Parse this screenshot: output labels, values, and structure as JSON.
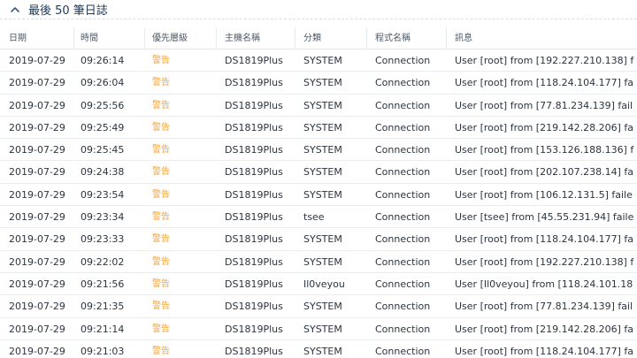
{
  "section": {
    "title": "最後 50 筆日誌",
    "icon": "chevron-up-icon"
  },
  "columns": {
    "date": "日期",
    "time": "時間",
    "level": "優先層級",
    "host": "主機名稱",
    "category": "分類",
    "program": "程式名稱",
    "message": "訊息"
  },
  "colors": {
    "warning": "#f0a33a",
    "header_text": "#233a55"
  },
  "rows": [
    {
      "date": "2019-07-29",
      "time": "09:26:14",
      "level": "警告",
      "host": "DS1819Plus",
      "category": "SYSTEM",
      "program": "Connection",
      "message": "User [root] from [192.227.210.138] f"
    },
    {
      "date": "2019-07-29",
      "time": "09:26:04",
      "level": "警告",
      "host": "DS1819Plus",
      "category": "SYSTEM",
      "program": "Connection",
      "message": "User [root] from [118.24.104.177] fa"
    },
    {
      "date": "2019-07-29",
      "time": "09:25:56",
      "level": "警告",
      "host": "DS1819Plus",
      "category": "SYSTEM",
      "program": "Connection",
      "message": "User [root] from [77.81.234.139] fail"
    },
    {
      "date": "2019-07-29",
      "time": "09:25:49",
      "level": "警告",
      "host": "DS1819Plus",
      "category": "SYSTEM",
      "program": "Connection",
      "message": "User [root] from [219.142.28.206] fa"
    },
    {
      "date": "2019-07-29",
      "time": "09:25:45",
      "level": "警告",
      "host": "DS1819Plus",
      "category": "SYSTEM",
      "program": "Connection",
      "message": "User [root] from [153.126.188.136] f"
    },
    {
      "date": "2019-07-29",
      "time": "09:24:38",
      "level": "警告",
      "host": "DS1819Plus",
      "category": "SYSTEM",
      "program": "Connection",
      "message": "User [root] from [202.107.238.14] fa"
    },
    {
      "date": "2019-07-29",
      "time": "09:23:54",
      "level": "警告",
      "host": "DS1819Plus",
      "category": "SYSTEM",
      "program": "Connection",
      "message": "User [root] from [106.12.131.5] faile"
    },
    {
      "date": "2019-07-29",
      "time": "09:23:34",
      "level": "警告",
      "host": "DS1819Plus",
      "category": "tsee",
      "program": "Connection",
      "message": "User [tsee] from [45.55.231.94] faile"
    },
    {
      "date": "2019-07-29",
      "time": "09:23:33",
      "level": "警告",
      "host": "DS1819Plus",
      "category": "SYSTEM",
      "program": "Connection",
      "message": "User [root] from [118.24.104.177] fa"
    },
    {
      "date": "2019-07-29",
      "time": "09:22:02",
      "level": "警告",
      "host": "DS1819Plus",
      "category": "SYSTEM",
      "program": "Connection",
      "message": "User [root] from [192.227.210.138] f"
    },
    {
      "date": "2019-07-29",
      "time": "09:21:56",
      "level": "警告",
      "host": "DS1819Plus",
      "category": "Il0veyou",
      "program": "Connection",
      "message": "User [Il0veyou] from [118.24.101.18"
    },
    {
      "date": "2019-07-29",
      "time": "09:21:35",
      "level": "警告",
      "host": "DS1819Plus",
      "category": "SYSTEM",
      "program": "Connection",
      "message": "User [root] from [77.81.234.139] fail"
    },
    {
      "date": "2019-07-29",
      "time": "09:21:14",
      "level": "警告",
      "host": "DS1819Plus",
      "category": "SYSTEM",
      "program": "Connection",
      "message": "User [root] from [219.142.28.206] fa"
    },
    {
      "date": "2019-07-29",
      "time": "09:21:03",
      "level": "警告",
      "host": "DS1819Plus",
      "category": "SYSTEM",
      "program": "Connection",
      "message": "User [root] from [118.24.104.177] fa"
    }
  ]
}
